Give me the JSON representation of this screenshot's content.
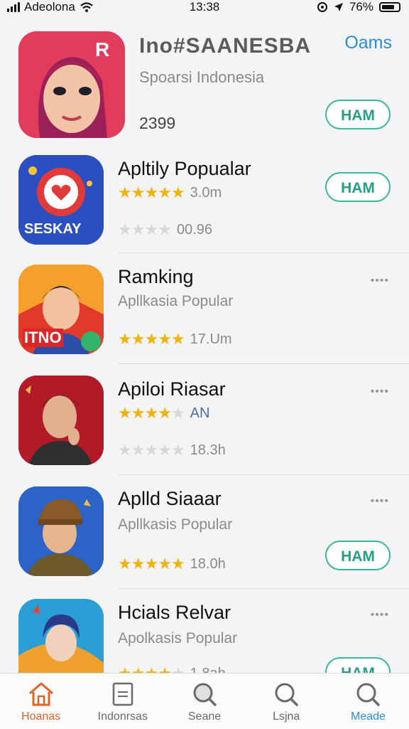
{
  "status_bar": {
    "carrier": "Adeolona",
    "time": "13:38",
    "battery": "76%",
    "battery_level": 0.76
  },
  "header": {
    "title": "Ino#SAANESBA",
    "link": "Oams",
    "subtitle": "Spoarsi Indonesia",
    "count": "2399",
    "button": "HAM"
  },
  "apps": [
    {
      "title": "Apltily Popualar",
      "rating_meta": "3.0m",
      "secondary_meta": "00.96",
      "rating": 4.5,
      "secondary_rating": 0,
      "button": "HAM"
    },
    {
      "title": "Ramking",
      "subtitle": "Apllkasia Popular",
      "rating_meta": "17.Um",
      "rating": 4.5,
      "more": "••••"
    },
    {
      "title": "Apiloi Riasar",
      "rating_meta": "AN",
      "secondary_meta": "18.3h",
      "rating": 4,
      "secondary_rating": 0,
      "more": "••••"
    },
    {
      "title": "Aplld Siaaar",
      "subtitle": "Apllkasis Popular",
      "rating_meta": "18.0h",
      "rating": 5,
      "more": "••••",
      "button": "HAM"
    },
    {
      "title": "Hcials Relvar",
      "subtitle": "Apolkasis Popular",
      "rating_meta": "1.8ah",
      "rating": 4,
      "more": "••••",
      "button": "HAM"
    }
  ],
  "icons": {
    "app0": {
      "label": "SESKAY"
    },
    "app1": {
      "label": "ITNO"
    }
  },
  "tabs": [
    {
      "label": "Hoanas",
      "icon": "home-icon"
    },
    {
      "label": "Indonrsas",
      "icon": "list-icon"
    },
    {
      "label": "Seane",
      "icon": "search-icon"
    },
    {
      "label": "Lsjna",
      "icon": "search-icon"
    },
    {
      "label": "Meade",
      "icon": "search-icon"
    }
  ],
  "colors": {
    "accent_green": "#39b89e",
    "link_blue": "#2a8fd4",
    "star": "#f1b20c",
    "tab_active": "#e0642a"
  }
}
